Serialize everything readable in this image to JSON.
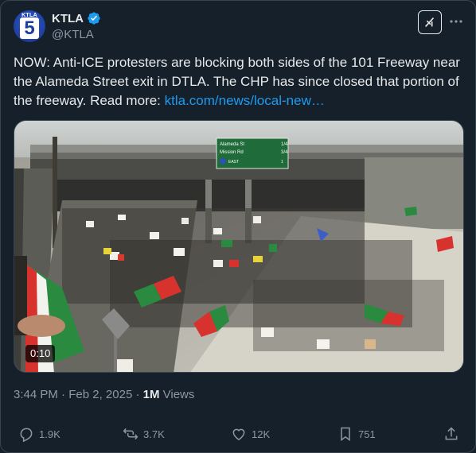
{
  "author": {
    "name": "KTLA",
    "handle": "@KTLA",
    "avatar_text_top": "KTLA",
    "avatar_text_number": "5"
  },
  "tweet": {
    "text": "NOW: Anti-ICE protesters are blocking both sides of the 101 Freeway near the Alameda Street exit in DTLA. The CHP has since closed that portion of the freeway. Read more: ",
    "link": "ktla.com/news/local-new…"
  },
  "media": {
    "duration": "0:10",
    "sign": {
      "line1": "Alameda St",
      "line1_fraction": "1/4",
      "line2": "Mission Rd",
      "line2_fraction": "3/4",
      "line3": "EAST",
      "line3_number": "1",
      "shield": "101"
    }
  },
  "meta": {
    "time": "3:44 PM",
    "separator": " · ",
    "date": "Feb 2, 2025",
    "views_count": "1M",
    "views_label": " Views"
  },
  "actions": {
    "replies": "1.9K",
    "reposts": "3.7K",
    "likes": "12K",
    "bookmarks": "751"
  },
  "colors": {
    "background": "#15202b",
    "accent": "#1d9bf0",
    "muted": "#8b98a5",
    "text": "#e7e9ea",
    "sign_green": "#1f6b3a"
  },
  "icons": {
    "verified": "verified-badge-icon",
    "grok": "grok-icon",
    "more": "more-dots-icon",
    "reply": "reply-icon",
    "repost": "repost-icon",
    "like": "heart-icon",
    "bookmark": "bookmark-icon",
    "share": "share-icon"
  }
}
